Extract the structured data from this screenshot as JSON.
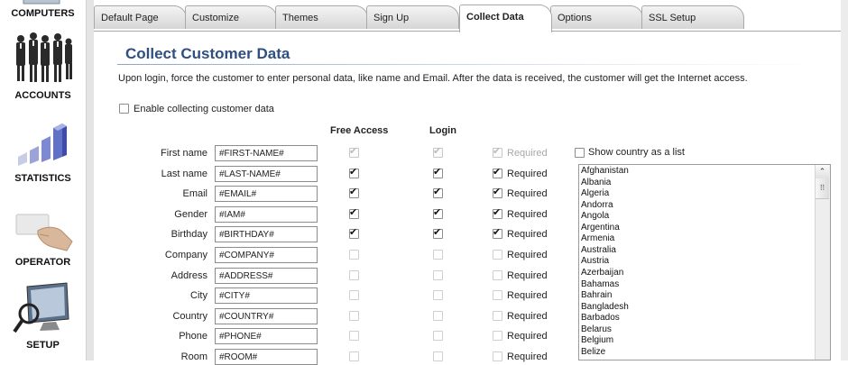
{
  "sidebar": {
    "items": [
      {
        "label": "COMPUTERS",
        "icon": "computers-icon"
      },
      {
        "label": "ACCOUNTS",
        "icon": "people-icon"
      },
      {
        "label": "STATISTICS",
        "icon": "bar-chart-icon"
      },
      {
        "label": "OPERATOR",
        "icon": "card-hand-icon"
      },
      {
        "label": "SETUP",
        "icon": "monitor-magnifier-icon"
      }
    ]
  },
  "tabs": [
    {
      "label": "Default Page"
    },
    {
      "label": "Customize"
    },
    {
      "label": "Themes"
    },
    {
      "label": "Sign Up"
    },
    {
      "label": "Collect Data",
      "active": true
    },
    {
      "label": "Options"
    },
    {
      "label": "SSL Setup"
    }
  ],
  "page": {
    "title": "Collect Customer Data",
    "intro": "Upon login, force the customer to enter personal data, like name and Email. After the data is received, the customer will get the Internet access.",
    "enable_label": "Enable collecting customer data",
    "enable_checked": false,
    "col_free_access": "Free Access",
    "col_login": "Login",
    "required_label": "Required",
    "show_country_label": "Show country as a list",
    "show_country_checked": false
  },
  "fields": [
    {
      "label": "First name",
      "value": "#FIRST-NAME#",
      "free": true,
      "login": true,
      "required": true,
      "disabled": true
    },
    {
      "label": "Last name",
      "value": "#LAST-NAME#",
      "free": true,
      "login": true,
      "required": true,
      "disabled": false
    },
    {
      "label": "Email",
      "value": "#EMAIL#",
      "free": true,
      "login": true,
      "required": true,
      "disabled": false
    },
    {
      "label": "Gender",
      "value": "#IAM#",
      "free": true,
      "login": true,
      "required": true,
      "disabled": false
    },
    {
      "label": "Birthday",
      "value": "#BIRTHDAY#",
      "free": true,
      "login": true,
      "required": true,
      "disabled": false
    },
    {
      "label": "Company",
      "value": "#COMPANY#",
      "free": false,
      "login": false,
      "required": false,
      "disabled": false
    },
    {
      "label": "Address",
      "value": "#ADDRESS#",
      "free": false,
      "login": false,
      "required": false,
      "disabled": false
    },
    {
      "label": "City",
      "value": "#CITY#",
      "free": false,
      "login": false,
      "required": false,
      "disabled": false
    },
    {
      "label": "Country",
      "value": "#COUNTRY#",
      "free": false,
      "login": false,
      "required": false,
      "disabled": false
    },
    {
      "label": "Phone",
      "value": "#PHONE#",
      "free": false,
      "login": false,
      "required": false,
      "disabled": false
    },
    {
      "label": "Room",
      "value": "#ROOM#",
      "free": false,
      "login": false,
      "required": false,
      "disabled": false
    }
  ],
  "countries": [
    "Afghanistan",
    "Albania",
    "Algeria",
    "Andorra",
    "Angola",
    "Argentina",
    "Armenia",
    "Australia",
    "Austria",
    "Azerbaijan",
    "Bahamas",
    "Bahrain",
    "Bangladesh",
    "Barbados",
    "Belarus",
    "Belgium",
    "Belize"
  ],
  "scrollbar": {
    "up_glyph": "⌃",
    "grip_glyph": "⠿"
  },
  "colors": {
    "title": "#2f4f80",
    "tab_border": "#a9a9a9"
  }
}
